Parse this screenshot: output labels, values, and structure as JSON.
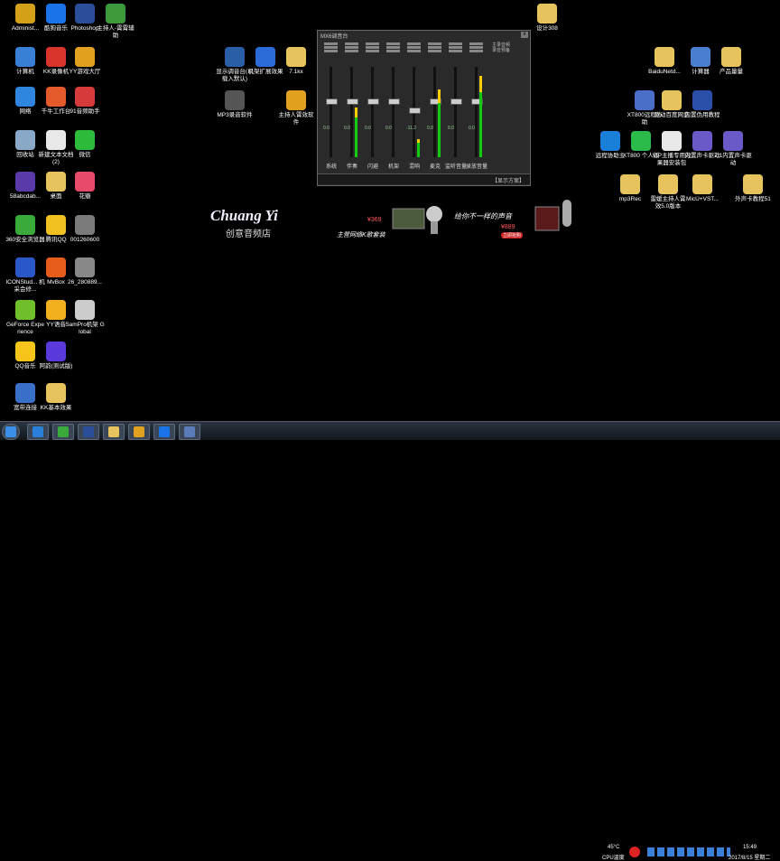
{
  "desktop_icons": [
    {
      "label": "Administ...",
      "color": "#d4a017"
    },
    {
      "label": "酷狗音乐",
      "color": "#1a73e8"
    },
    {
      "label": "Photoshop",
      "color": "#2a4e9a"
    },
    {
      "label": "主持人-霄霄辅助",
      "color": "#3c9a3c"
    },
    {
      "label": "计算机",
      "color": "#3a7fd6"
    },
    {
      "label": "KK录像机",
      "color": "#d9342b"
    },
    {
      "label": "YY游戏大厅",
      "color": "#e0a020"
    },
    {
      "label": "网络",
      "color": "#2e86de"
    },
    {
      "label": "千牛工作台",
      "color": "#e55a2b"
    },
    {
      "label": "91音频助手",
      "color": "#d63a3a"
    },
    {
      "label": "回收站",
      "color": "#8aa8c8"
    },
    {
      "label": "新建文本文档(2)",
      "color": "#e8e8e8"
    },
    {
      "label": "微信",
      "color": "#2dbb3b"
    },
    {
      "label": "58abcdab...",
      "color": "#5a3aa8"
    },
    {
      "label": "桌面",
      "color": "#e6c35c"
    },
    {
      "label": "花瓣",
      "color": "#e84a6b"
    },
    {
      "label": "360安全浏览器",
      "color": "#3aaa3a"
    },
    {
      "label": "腾讯QQ",
      "color": "#f0c020"
    },
    {
      "label": "001260600",
      "color": "#7a7a7a"
    },
    {
      "label": "ICONStud... 机采会修...",
      "color": "#2b58c8"
    },
    {
      "label": "MvBox",
      "color": "#e65c1a"
    },
    {
      "label": "26_280889...",
      "color": "#888888"
    },
    {
      "label": "GeForce Experience",
      "color": "#6fbf2a"
    },
    {
      "label": "YY语音",
      "color": "#f2b01e"
    },
    {
      "label": "SamPro机架 Global",
      "color": "#cccccc"
    },
    {
      "label": "QQ音乐",
      "color": "#f6c51a"
    },
    {
      "label": "阿韵(测试版)",
      "color": "#5a3adb"
    },
    {
      "label": "宽带连接",
      "color": "#3a6fc8"
    },
    {
      "label": "KK基本效果",
      "color": "#e6c35c"
    },
    {
      "label": "显示调音台(以载入默认)",
      "color": "#2a5fa8"
    },
    {
      "label": "机架扩展效果",
      "color": "#2a6bd8"
    },
    {
      "label": "7.1kx",
      "color": "#e6c35c"
    },
    {
      "label": "MP3录音软件",
      "color": "#555555"
    },
    {
      "label": "主持人霄效软件",
      "color": "#e0a020"
    },
    {
      "label": "设计308",
      "color": "#e6c35c"
    },
    {
      "label": "BaiduNetd...",
      "color": "#e6c35c"
    },
    {
      "label": "计算器",
      "color": "#4a7fd0"
    },
    {
      "label": "产品量量",
      "color": "#e6c35c"
    },
    {
      "label": "XT800远程协助",
      "color": "#4a6fc8"
    },
    {
      "label": "驱动百度网盘",
      "color": "#e6c35c"
    },
    {
      "label": "内置伪用教程",
      "color": "#2a4fa8"
    },
    {
      "label": "远程协助主",
      "color": "#1a7fd8"
    },
    {
      "label": "XT800 个人版",
      "color": "#2abb4a"
    },
    {
      "label": "VIP主播专用效果器安装包",
      "color": "#e8e8e8"
    },
    {
      "label": "内置声卡驱动",
      "color": "#6a5ac8"
    },
    {
      "label": "7.1内置声卡驱动",
      "color": "#6a5ac8"
    },
    {
      "label": "mp3Rec",
      "color": "#e6c35c"
    },
    {
      "label": "雷媛主持人霄效5.0版本",
      "color": "#e6c35c"
    },
    {
      "label": "MicU+VST...",
      "color": "#e6c35c"
    },
    {
      "label": "外声卡教程51",
      "color": "#e6c35c"
    }
  ],
  "mixer": {
    "title": "MX6调音台",
    "close": "x",
    "channels": [
      {
        "name": "系统",
        "value": "0.0",
        "level": 0.0,
        "fader": 0.35
      },
      {
        "name": "伴奏",
        "value": "0.0",
        "level": 0.55,
        "fader": 0.35
      },
      {
        "name": "闪避",
        "value": "0.0",
        "level": 0.0,
        "fader": 0.35
      },
      {
        "name": "机架",
        "value": "0.0",
        "level": 0.0,
        "fader": 0.35
      },
      {
        "name": "混响",
        "value": "-11.2",
        "level": 0.2,
        "fader": 0.45
      },
      {
        "name": "麦克",
        "value": "0.0",
        "level": 0.75,
        "fader": 0.35
      },
      {
        "name": "监听音量",
        "value": "0.0",
        "level": 0.0,
        "fader": 0.35
      },
      {
        "name": "录放音量",
        "value": "0.0",
        "level": 0.9,
        "fader": 0.35
      }
    ],
    "side_labels": [
      "主录音频",
      "录音预备"
    ],
    "footer": "【显示方案】"
  },
  "wallpaper": {
    "brand": "Chuang Yi",
    "brand_sub": "创意音频店",
    "slogan1": "主营网络K歌套装",
    "slogan2": "给你不一样的声音",
    "price1": "¥369",
    "price2": "¥889",
    "tag": "立即抢购"
  },
  "taskbar": {
    "items": [
      {
        "name": "start",
        "color": "#3a8fe8"
      },
      {
        "name": "ie",
        "color": "#2a7fd8"
      },
      {
        "name": "360",
        "color": "#3aaa3a"
      },
      {
        "name": "photoshop",
        "color": "#2a4e9a"
      },
      {
        "name": "folder",
        "color": "#e6c35c"
      },
      {
        "name": "media",
        "color": "#e0a020"
      },
      {
        "name": "kugou",
        "color": "#1a73e8"
      },
      {
        "name": "tool",
        "color": "#5a7ab8"
      }
    ],
    "temp": "45°C",
    "cpu": "CPU温度",
    "time": "15:49",
    "date": "2017/8/15 星期二"
  }
}
